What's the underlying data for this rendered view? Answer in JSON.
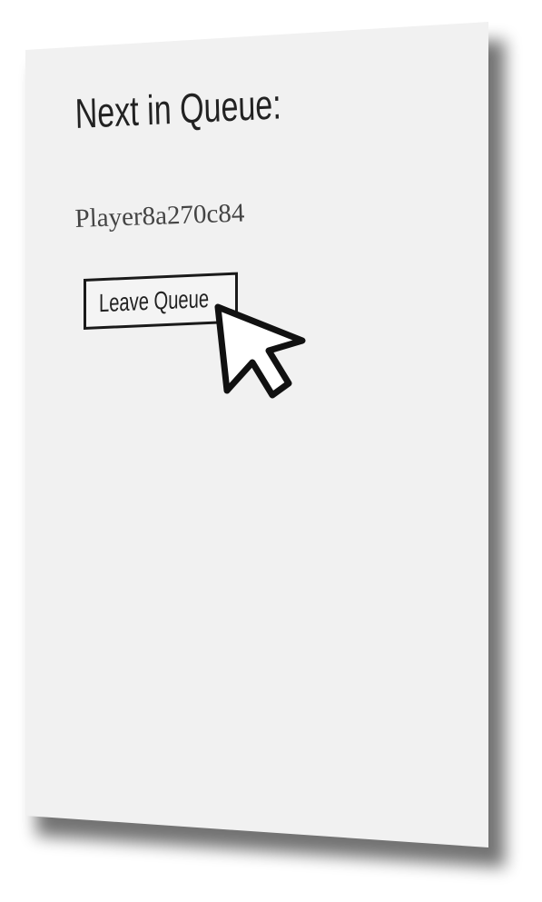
{
  "queue": {
    "title": "Next in Queue:",
    "player_name": "Player8a270c84",
    "leave_button_label": "Leave Queue"
  },
  "cursor": {
    "icon": "arrow-cursor-icon"
  },
  "colors": {
    "panel_background": "#f1f1f1",
    "text": "#222222",
    "button_border": "#1a1a1a"
  }
}
